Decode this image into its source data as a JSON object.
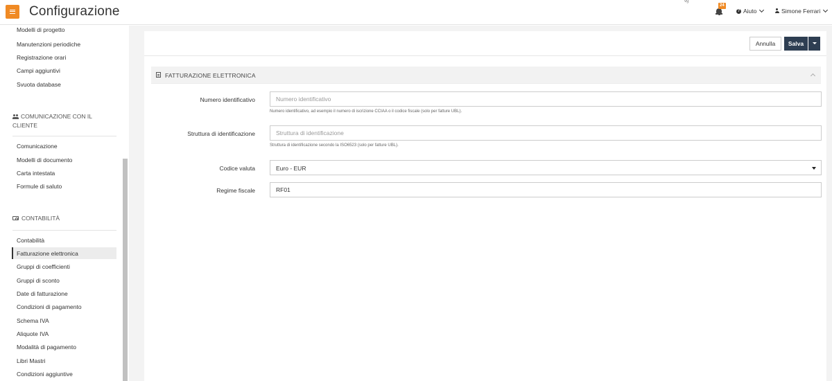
{
  "header": {
    "title": "Configurazione",
    "mark": "vg",
    "notifications_count": "24",
    "help_label": "Aiuto",
    "user_name": "Simone Ferrari"
  },
  "sidebar": {
    "top_items": [
      {
        "label": "Modelli di progetto"
      },
      {
        "label": "Manutenzioni periodiche"
      },
      {
        "label": "Registrazione orari"
      },
      {
        "label": "Campi aggiuntivi"
      },
      {
        "label": "Svuota database"
      }
    ],
    "section_communication": {
      "title": "COMUNICAZIONE CON IL CLIENTE",
      "items": [
        {
          "label": "Comunicazione"
        },
        {
          "label": "Modelli di documento"
        },
        {
          "label": "Carta intestata"
        },
        {
          "label": "Formule di saluto"
        }
      ]
    },
    "section_accounting": {
      "title": "CONTABILITÀ",
      "items": [
        {
          "label": "Contabilità"
        },
        {
          "label": "Fatturazione elettronica"
        },
        {
          "label": "Gruppi di coefficienti"
        },
        {
          "label": "Gruppi di sconto"
        },
        {
          "label": "Date di fatturazione"
        },
        {
          "label": "Condizioni di pagamento"
        },
        {
          "label": "Schema IVA"
        },
        {
          "label": "Aliquote IVA"
        },
        {
          "label": "Modalità di pagamento"
        },
        {
          "label": "Libri Mastri"
        },
        {
          "label": "Condizioni aggiuntive"
        }
      ]
    }
  },
  "toolbar": {
    "cancel_label": "Annulla",
    "save_label": "Salva"
  },
  "section": {
    "title": "FATTURAZIONE ELETTRONICA"
  },
  "form": {
    "identifier": {
      "label": "Numero identificativo",
      "value": "",
      "placeholder": "Numero identificativo",
      "help": "Numero identificativo, ad esempio il numero di iscrizione CCIAA o il codice fiscale (solo per fatture UBL)."
    },
    "identification_structure": {
      "label": "Struttura di identificazione",
      "value": "",
      "placeholder": "Struttura di identificazione",
      "help": "Struttura di identificazione secondo la ISO6523 (solo per fatture UBL)."
    },
    "currency": {
      "label": "Codice valuta",
      "selected": "Euro - EUR"
    },
    "tax_regime": {
      "label": "Regime fiscale",
      "value": "RF01"
    }
  },
  "colors": {
    "accent": "#f08a24",
    "primary_button": "#2e3e52"
  }
}
